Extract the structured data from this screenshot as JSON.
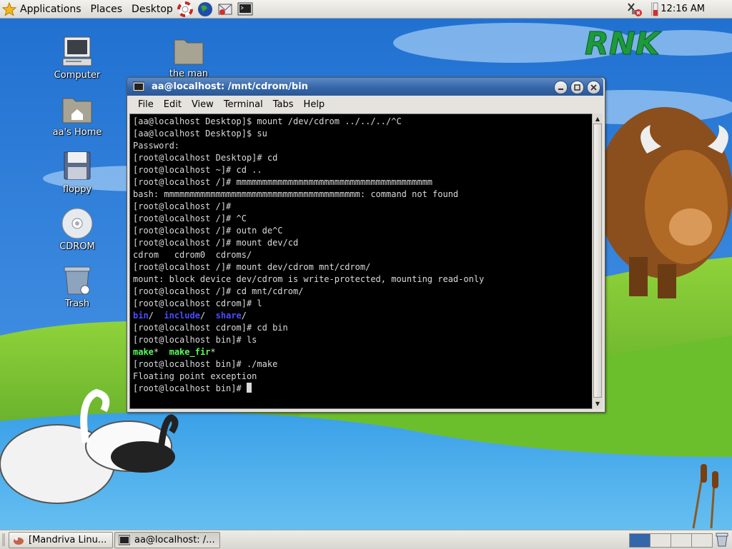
{
  "top_panel": {
    "menus": [
      "Applications",
      "Places",
      "Desktop"
    ],
    "launchers": [
      "help-icon",
      "web-browser-icon",
      "email-icon",
      "terminal-icon"
    ],
    "clock": "12:16 AM"
  },
  "wallpaper": {
    "logo_text": "RNK"
  },
  "desktop_icons": [
    {
      "label": "Computer",
      "icon": "computer-icon"
    },
    {
      "label": "aa's Home",
      "icon": "home-folder-icon"
    },
    {
      "label": "floppy",
      "icon": "floppy-icon"
    },
    {
      "label": "CDROM",
      "icon": "cdrom-icon"
    },
    {
      "label": "Trash",
      "icon": "trash-icon"
    },
    {
      "label": "the man",
      "icon": "folder-icon"
    }
  ],
  "terminal": {
    "title": "aa@localhost: /mnt/cdrom/bin",
    "menu": [
      "File",
      "Edit",
      "View",
      "Terminal",
      "Tabs",
      "Help"
    ],
    "lines": [
      "[aa@localhost Desktop]$ mount /dev/cdrom ../../../^C",
      "[aa@localhost Desktop]$ su",
      "Password:",
      "[root@localhost Desktop]# cd",
      "[root@localhost ~]# cd ..",
      "[root@localhost /]# mmmmmmmmmmmmmmmmmmmmmmmmmmmmmmmmmmmmmm",
      "bash: mmmmmmmmmmmmmmmmmmmmmmmmmmmmmmmmmmmmmm: command not found",
      "[root@localhost /]#",
      "[root@localhost /]# ^C",
      "[root@localhost /]# outn de^C",
      "[root@localhost /]# mount dev/cd",
      "cdrom   cdrom0  cdroms/",
      "[root@localhost /]# mount dev/cdrom mnt/cdrom/",
      "mount: block device dev/cdrom is write-protected, mounting read-only",
      "[root@localhost /]# cd mnt/cdrom/",
      "[root@localhost cdrom]# l",
      "",
      "[root@localhost cdrom]# cd bin",
      "[root@localhost bin]# ls",
      "",
      "[root@localhost bin]# ./make",
      "Floating point exception",
      "[root@localhost bin]# "
    ],
    "ls_dirs": [
      "bin",
      "include",
      "share"
    ],
    "ls_exec": [
      "make",
      "make_fir"
    ]
  },
  "taskbar": {
    "tasks": [
      "[Mandriva Linu...",
      "aa@localhost: /..."
    ]
  },
  "colors": {
    "titlebar": "#3566a8",
    "terminal_bg": "#000000",
    "terminal_fg": "#d9d9d9",
    "dir_color": "#4a4bff",
    "exec_color": "#55ff55"
  }
}
